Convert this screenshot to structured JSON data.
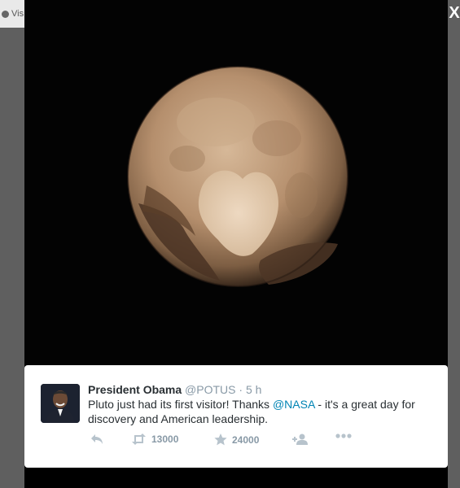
{
  "background_tab": {
    "label": "Vis"
  },
  "lightbox": {
    "close_label": "X"
  },
  "tweet": {
    "full_name": "President Obama",
    "screen_name": "@POTUS",
    "separator": "·",
    "timestamp": "5 h",
    "text_before": "Pluto just had its first visitor! Thanks ",
    "mention": "@NASA",
    "text_after": " - it's a great day for discovery and American leadership.",
    "actions": {
      "reply_icon": "reply-icon",
      "retweet_icon": "retweet-icon",
      "retweet_count": "13000",
      "favorite_icon": "star-icon",
      "favorite_count": "24000",
      "follow_icon": "follow-user-icon",
      "more_icon": "more-dots-icon"
    }
  },
  "colors": {
    "name": "#292f33",
    "muted": "#8899a6",
    "link": "#0084b4",
    "lightbox_bg": "#000000"
  }
}
